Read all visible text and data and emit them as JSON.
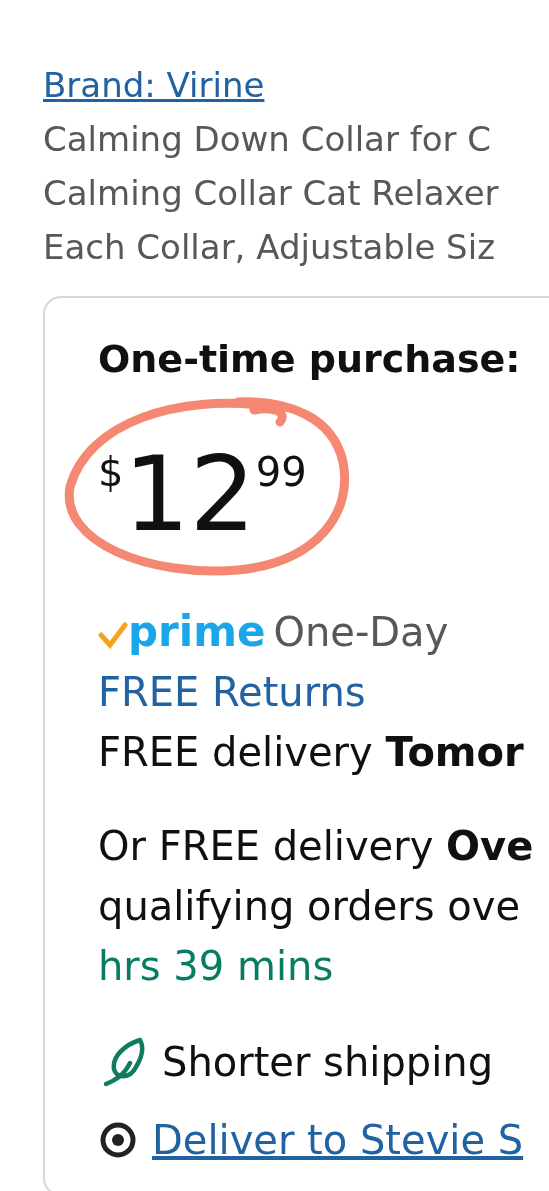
{
  "brand_link": "Brand: Virine",
  "title_lines": [
    "Calming Down Collar for C",
    "Calming Collar Cat Relaxer",
    "Each Collar, Adjustable Siz"
  ],
  "buy_box": {
    "heading": "One-time purchase:",
    "price": {
      "currency": "$",
      "whole": "12",
      "fraction": "99",
      "annotated": true
    },
    "prime_badge": "prime",
    "prime_label": "One-Day",
    "returns_link": "FREE Returns",
    "delivery": "FREE delivery **Tomor**",
    "alt_delivery_lines": [
      "Or FREE delivery **Ove**",
      "qualifying orders ove"
    ],
    "countdown": "hrs 39 mins",
    "eco_note": "Shorter shipping",
    "location_link": "Deliver to Stevie S"
  }
}
